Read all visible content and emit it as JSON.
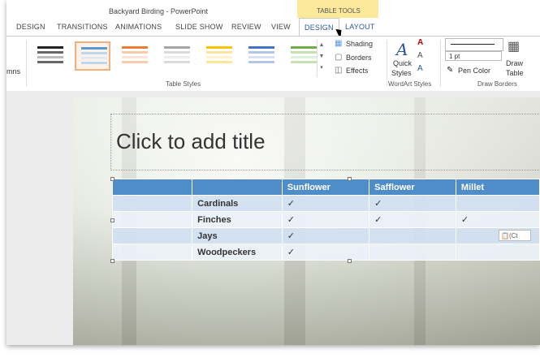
{
  "window": {
    "title": "Backyard Birding - PowerPoint",
    "context_header": "TABLE TOOLS"
  },
  "tabs": [
    "DESIGN",
    "TRANSITIONS",
    "ANIMATIONS",
    "SLIDE SHOW",
    "REVIEW",
    "VIEW",
    "DESIGN",
    "LAYOUT"
  ],
  "ribbon": {
    "left_partial": "mns",
    "table_styles_label": "Table Styles",
    "shading": "Shading",
    "borders": "Borders",
    "effects": "Effects",
    "quick_styles_1": "Quick",
    "quick_styles_2": "Styles",
    "wordart_label": "WordArt Styles",
    "pen_weight": "1 pt",
    "pen_color": "Pen Color",
    "draw_table_1": "Draw",
    "draw_table_2": "Table",
    "draw_borders_label": "Draw Borders",
    "swatch_colors": [
      "#222222",
      "#5b9bd5",
      "#ed7d31",
      "#a5a5a5",
      "#ffc000",
      "#4472c4",
      "#70ad47"
    ]
  },
  "slide": {
    "title_placeholder": "Click to add title",
    "table": {
      "headers": [
        "",
        "Sunflower",
        "Safflower",
        "Millet"
      ],
      "rows": [
        [
          "Cardinals",
          "✓",
          "✓",
          ""
        ],
        [
          "Finches",
          "✓",
          "✓",
          "✓"
        ],
        [
          "Jays",
          "✓",
          "",
          ""
        ],
        [
          "Woodpeckers",
          "✓",
          "",
          ""
        ]
      ]
    },
    "paste_options": "(Ct"
  }
}
